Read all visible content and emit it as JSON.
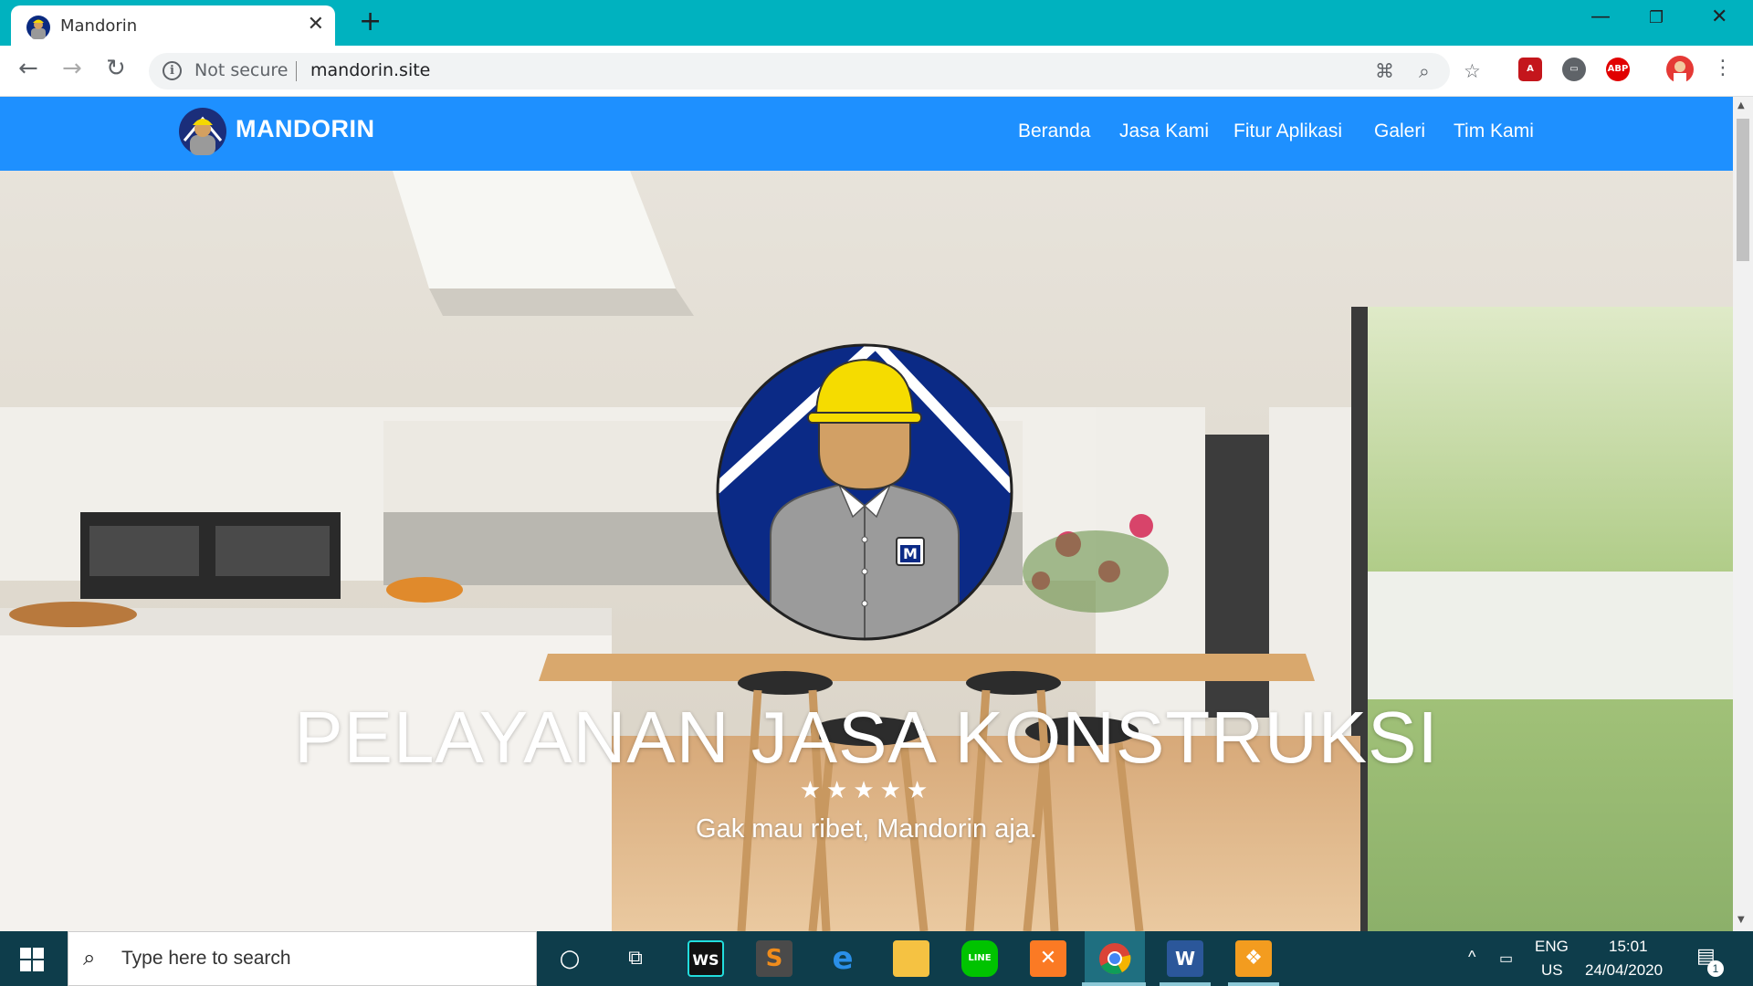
{
  "browser": {
    "tab_title": "Mandorin",
    "security_label": "Not secure",
    "url": "mandorin.site",
    "new_tab_symbol": "+",
    "tab_close_symbol": "✕",
    "theme_color": "#00b2bf"
  },
  "site": {
    "brand": "MANDORIN",
    "nav_color": "#1e90ff",
    "nav": [
      {
        "label": "Beranda"
      },
      {
        "label": "Jasa Kami"
      },
      {
        "label": "Fitur Aplikasi"
      },
      {
        "label": "Galeri"
      },
      {
        "label": "Tim Kami"
      }
    ],
    "hero": {
      "title": "PELAYANAN JASA KONSTRUKSI",
      "stars": "★★★★★",
      "subtitle": "Gak mau ribet, Mandorin aja.",
      "logo_badge_letter": "M"
    }
  },
  "extensions": {
    "abp": "ABP"
  },
  "taskbar": {
    "search_placeholder": "Type here to search",
    "apps": [
      "cortana-icon",
      "task-view-icon",
      "webstorm-icon",
      "sublime-icon",
      "edge-icon",
      "file-explorer-icon",
      "line-icon",
      "xampp-icon",
      "chrome-icon",
      "word-icon",
      "pdf-icon"
    ],
    "ws_label": "WS",
    "word_label": "W",
    "line_label": "LINE",
    "lang_top": "ENG",
    "lang_bottom": "US",
    "time": "15:01",
    "date": "24/04/2020",
    "notification_count": "1"
  }
}
